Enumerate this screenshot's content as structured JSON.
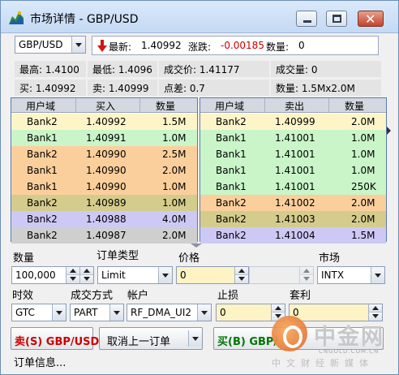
{
  "window": {
    "title": "市场详情 - GBP/USD"
  },
  "symbol_select": {
    "value": "GBP/USD"
  },
  "quote": {
    "latest_label": "最新:",
    "latest_value": "1.40992",
    "change_label": "涨跌:",
    "change_value": "-0.00185",
    "qty_label": "数量:",
    "qty_value": "0"
  },
  "stats": {
    "high": "最高: 1.4100",
    "low": "最低: 1.4096",
    "trade_price": "成交价: 1.41177",
    "volume": "成交量: 0",
    "buy": "买: 1.40992",
    "sell": "卖: 1.40999",
    "spread": "点差: 0.7",
    "qty": "数量: 1.5Mx2.0M"
  },
  "bid_table": {
    "headers": [
      "用户域",
      "买入",
      "数量"
    ],
    "rows": [
      {
        "domain": "Bank2",
        "price": "1.40992",
        "qty": "1.5M",
        "bg": "#fdf5c8"
      },
      {
        "domain": "Bank1",
        "price": "1.40991",
        "qty": "1.0M",
        "bg": "#c9f5c9"
      },
      {
        "domain": "Bank2",
        "price": "1.40990",
        "qty": "2.5M",
        "bg": "#fbcf9c"
      },
      {
        "domain": "Bank1",
        "price": "1.40990",
        "qty": "2.0M",
        "bg": "#fbcf9c"
      },
      {
        "domain": "Bank1",
        "price": "1.40990",
        "qty": "1.0M",
        "bg": "#fbcf9c"
      },
      {
        "domain": "Bank2",
        "price": "1.40989",
        "qty": "1.0M",
        "bg": "#d4cc8c"
      },
      {
        "domain": "Bank2",
        "price": "1.40988",
        "qty": "4.0M",
        "bg": "#cdc9f5"
      },
      {
        "domain": "Bank2",
        "price": "1.40987",
        "qty": "2.0M",
        "bg": "#cfcfcf"
      }
    ]
  },
  "ask_table": {
    "headers": [
      "用户域",
      "卖出",
      "数量"
    ],
    "rows": [
      {
        "domain": "Bank2",
        "price": "1.40999",
        "qty": "2.0M",
        "bg": "#fdf5c8"
      },
      {
        "domain": "Bank1",
        "price": "1.41001",
        "qty": "1.0M",
        "bg": "#c9f5c9"
      },
      {
        "domain": "Bank1",
        "price": "1.41001",
        "qty": "1.0M",
        "bg": "#c9f5c9"
      },
      {
        "domain": "Bank1",
        "price": "1.41001",
        "qty": "1.0M",
        "bg": "#c9f5c9"
      },
      {
        "domain": "Bank1",
        "price": "1.41001",
        "qty": "250K",
        "bg": "#c9f5c9"
      },
      {
        "domain": "Bank2",
        "price": "1.41002",
        "qty": "2.0M",
        "bg": "#fbcf9c"
      },
      {
        "domain": "Bank2",
        "price": "1.41003",
        "qty": "2.0M",
        "bg": "#d4cc8c"
      },
      {
        "domain": "Bank2",
        "price": "1.41004",
        "qty": "1.5M",
        "bg": "#cdc9f5"
      }
    ]
  },
  "order": {
    "qty_label": "数量",
    "qty_value": "100,000",
    "type_label": "订单类型",
    "type_value": "Limit",
    "price_label": "价格",
    "price_value": "0",
    "market_label": "市场",
    "market_value": "INTX",
    "tif_label": "时效",
    "tif_value": "GTC",
    "fill_label": "成交方式",
    "fill_value": "PART",
    "account_label": "帐户",
    "account_value": "RF_DMA_UI2",
    "stop_label": "止损",
    "stop_value": "0",
    "tp_label": "套利",
    "tp_value": "0"
  },
  "actions": {
    "sell_label": "卖(S) GBP/USD",
    "cancel_label": "取消上一订单",
    "buy_label": "买(B) GBP/"
  },
  "status": {
    "text": "订单信息..."
  },
  "watermark": {
    "brand": "中金网",
    "url": "CNGOLD.COM.CN",
    "tagline": "中文财经新媒体"
  },
  "colors": {
    "sell_text": "#cc0000",
    "buy_text": "#007700",
    "change_text": "#cc0000",
    "table_border": "#5b7bb0",
    "input_highlight": "#fdf3c4"
  }
}
